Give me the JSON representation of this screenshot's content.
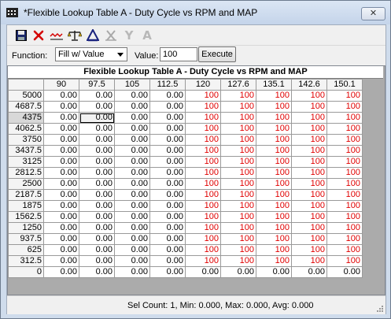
{
  "window": {
    "title": "*Flexible Lookup Table A - Duty Cycle vs RPM and MAP",
    "close_label": "✕"
  },
  "toolbar": {
    "icons": [
      "save-icon",
      "delete-icon",
      "graph-icon",
      "balance-icon",
      "delta-icon",
      "trim-icon",
      "axis-icon",
      "text-icon"
    ],
    "text_y": "Y",
    "text_a": "A"
  },
  "function_row": {
    "function_label": "Function:",
    "function_value": "Fill w/ Value",
    "value_label": "Value:",
    "value_input": "100",
    "execute_label": "Execute"
  },
  "table": {
    "title": "Flexible Lookup Table A - Duty Cycle vs RPM and MAP",
    "columns": [
      "90",
      "97.5",
      "105",
      "112.5",
      "120",
      "127.6",
      "135.1",
      "142.6",
      "150.1"
    ],
    "rows": [
      {
        "label": "5000",
        "cells": [
          "0.00",
          "0.00",
          "0.00",
          "0.00",
          "100",
          "100",
          "100",
          "100",
          "100"
        ]
      },
      {
        "label": "4687.5",
        "cells": [
          "0.00",
          "0.00",
          "0.00",
          "0.00",
          "100",
          "100",
          "100",
          "100",
          "100"
        ]
      },
      {
        "label": "4375",
        "cells": [
          "0.00",
          "0.00",
          "0.00",
          "0.00",
          "100",
          "100",
          "100",
          "100",
          "100"
        ]
      },
      {
        "label": "4062.5",
        "cells": [
          "0.00",
          "0.00",
          "0.00",
          "0.00",
          "100",
          "100",
          "100",
          "100",
          "100"
        ]
      },
      {
        "label": "3750",
        "cells": [
          "0.00",
          "0.00",
          "0.00",
          "0.00",
          "100",
          "100",
          "100",
          "100",
          "100"
        ]
      },
      {
        "label": "3437.5",
        "cells": [
          "0.00",
          "0.00",
          "0.00",
          "0.00",
          "100",
          "100",
          "100",
          "100",
          "100"
        ]
      },
      {
        "label": "3125",
        "cells": [
          "0.00",
          "0.00",
          "0.00",
          "0.00",
          "100",
          "100",
          "100",
          "100",
          "100"
        ]
      },
      {
        "label": "2812.5",
        "cells": [
          "0.00",
          "0.00",
          "0.00",
          "0.00",
          "100",
          "100",
          "100",
          "100",
          "100"
        ]
      },
      {
        "label": "2500",
        "cells": [
          "0.00",
          "0.00",
          "0.00",
          "0.00",
          "100",
          "100",
          "100",
          "100",
          "100"
        ]
      },
      {
        "label": "2187.5",
        "cells": [
          "0.00",
          "0.00",
          "0.00",
          "0.00",
          "100",
          "100",
          "100",
          "100",
          "100"
        ]
      },
      {
        "label": "1875",
        "cells": [
          "0.00",
          "0.00",
          "0.00",
          "0.00",
          "100",
          "100",
          "100",
          "100",
          "100"
        ]
      },
      {
        "label": "1562.5",
        "cells": [
          "0.00",
          "0.00",
          "0.00",
          "0.00",
          "100",
          "100",
          "100",
          "100",
          "100"
        ]
      },
      {
        "label": "1250",
        "cells": [
          "0.00",
          "0.00",
          "0.00",
          "0.00",
          "100",
          "100",
          "100",
          "100",
          "100"
        ]
      },
      {
        "label": "937.5",
        "cells": [
          "0.00",
          "0.00",
          "0.00",
          "0.00",
          "100",
          "100",
          "100",
          "100",
          "100"
        ]
      },
      {
        "label": "625",
        "cells": [
          "0.00",
          "0.00",
          "0.00",
          "0.00",
          "100",
          "100",
          "100",
          "100",
          "100"
        ]
      },
      {
        "label": "312.5",
        "cells": [
          "0.00",
          "0.00",
          "0.00",
          "0.00",
          "100",
          "100",
          "100",
          "100",
          "100"
        ]
      },
      {
        "label": "0",
        "cells": [
          "0.00",
          "0.00",
          "0.00",
          "0.00",
          "0.00",
          "0.00",
          "0.00",
          "0.00",
          "0.00"
        ]
      }
    ],
    "selected_row": 2,
    "selected_col": 1,
    "highlight_value": "100",
    "highlight_color": "#e00000"
  },
  "status": {
    "text": "Sel Count: 1, Min: 0.000, Max: 0.000, Avg: 0.000"
  },
  "colors": {
    "title_bar": "#c4d4ea",
    "value_red": "#e00000",
    "grid_bg": "#ababab"
  }
}
